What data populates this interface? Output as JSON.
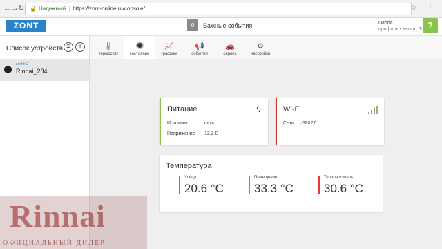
{
  "browser": {
    "secure_label": "Надежный",
    "url": "https://zont-online.ru/console/"
  },
  "header": {
    "logo": "ZONT",
    "events_count": "0",
    "events_label": "Важные события",
    "user_name": "Dadda",
    "user_links": "профиль • выход",
    "help_label": "?"
  },
  "sidebar": {
    "title": "Список устройств",
    "device": {
      "model": "zont h-2",
      "name": "Rinnai_284"
    }
  },
  "tabs": [
    {
      "label": "термостат",
      "icon": "thermometer-icon"
    },
    {
      "label": "состояние",
      "icon": "status-icon",
      "active": true
    },
    {
      "label": "графики",
      "icon": "chart-icon"
    },
    {
      "label": "события",
      "icon": "events-icon"
    },
    {
      "label": "сервис",
      "icon": "service-icon"
    },
    {
      "label": "настройки",
      "icon": "settings-icon"
    }
  ],
  "power": {
    "title": "Питание",
    "source_label": "Источник",
    "source_value": "сеть",
    "voltage_label": "Напряжение",
    "voltage_value": "12.2 В"
  },
  "wifi": {
    "title": "Wi-Fi",
    "network_label": "Сеть",
    "network_value": "p38027"
  },
  "temperature": {
    "title": "Температура",
    "sensors": [
      {
        "label": "Улица",
        "value": "20.6 °C",
        "color": "#3a8fd6"
      },
      {
        "label": "Помещение",
        "value": "33.3 °C",
        "color": "#4caf50"
      },
      {
        "label": "Теплоноситель",
        "value": "30.6 °C",
        "color": "#e53935"
      }
    ]
  },
  "watermark": {
    "brand": "Rinnai",
    "tagline": "ОФИЦИАЛЬНЫЙ ДИЛЕР"
  },
  "colors": {
    "brand_blue": "#2b82cc",
    "help_green": "#8bc34a",
    "power_accent": "#8bc34a",
    "wifi_accent": "#c0392b"
  }
}
